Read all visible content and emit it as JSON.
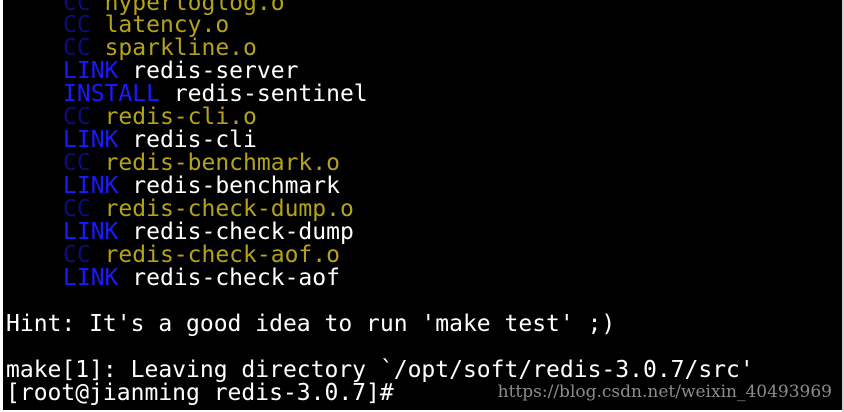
{
  "terminal": {
    "build_lines": [
      {
        "tag": "CC",
        "target": "hyperloglog.o"
      },
      {
        "tag": "CC",
        "target": "latency.o"
      },
      {
        "tag": "CC",
        "target": "sparkline.o"
      },
      {
        "tag": "LINK",
        "target": "redis-server"
      },
      {
        "tag": "INSTALL",
        "target": "redis-sentinel"
      },
      {
        "tag": "CC",
        "target": "redis-cli.o"
      },
      {
        "tag": "LINK",
        "target": "redis-cli"
      },
      {
        "tag": "CC",
        "target": "redis-benchmark.o"
      },
      {
        "tag": "LINK",
        "target": "redis-benchmark"
      },
      {
        "tag": "CC",
        "target": "redis-check-dump.o"
      },
      {
        "tag": "LINK",
        "target": "redis-check-dump"
      },
      {
        "tag": "CC",
        "target": "redis-check-aof.o"
      },
      {
        "tag": "LINK",
        "target": "redis-check-aof"
      }
    ],
    "hint": "Hint: It's a good idea to run 'make test' ;)",
    "leaving": "make[1]: Leaving directory `/opt/soft/redis-3.0.7/src'",
    "prompt": "[root@jianming redis-3.0.7]#",
    "watermark": "https://blog.csdn.net/weixin_40493969"
  },
  "colors": {
    "background": "#000000",
    "cc_tag": "#1717e0",
    "link_tag": "#1a1aff",
    "object_file": "#b3a21a",
    "binary": "#ffffff"
  }
}
